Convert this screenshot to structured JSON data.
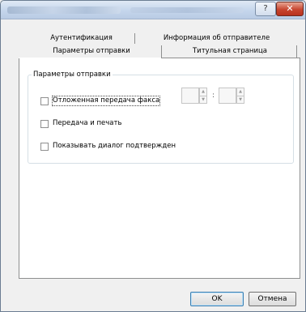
{
  "window": {
    "help_glyph": "?",
    "close_glyph": "✕"
  },
  "tabs": {
    "top": [
      "Аутентификация",
      "Информация об отправителе"
    ],
    "bottom": [
      "Параметры отправки",
      "Титульная страница"
    ],
    "active": "Параметры отправки"
  },
  "group": {
    "title": "Параметры отправки",
    "options": [
      {
        "label": "Отложенная передача факса",
        "checked": false
      },
      {
        "label": "Передача и печать",
        "checked": false
      },
      {
        "label": "Показывать диалог подтвержден",
        "checked": false
      }
    ],
    "time_separator": ":"
  },
  "buttons": {
    "ok": "OK",
    "cancel": "Отмена"
  },
  "icons": {
    "spin_up": "▲",
    "spin_down": "▼"
  }
}
